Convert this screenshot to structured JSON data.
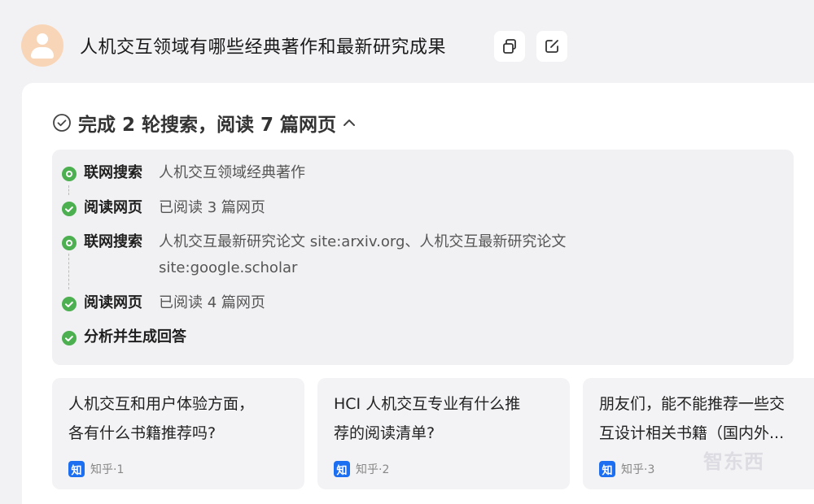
{
  "header": {
    "question": "人机交互领域有哪些经典著作和最新研究成果",
    "copy_icon": "copy-icon",
    "edit_icon": "edit-icon"
  },
  "summary": {
    "text": "完成 2 轮搜索，阅读 7 篇网页",
    "expand_icon": "chevron-up-icon"
  },
  "steps": [
    {
      "label": "联网搜索",
      "detail": "人机交互领域经典著作",
      "icon": "search-step-icon"
    },
    {
      "label": "阅读网页",
      "detail": "已阅读 3 篇网页",
      "icon": "check-icon"
    },
    {
      "label": "联网搜索",
      "detail": "人机交互最新研究论文 site:arxiv.org、人机交互最新研究论文",
      "detail2": "site:google.scholar",
      "icon": "search-step-icon"
    },
    {
      "label": "阅读网页",
      "detail": "已阅读 4 篇网页",
      "icon": "check-icon"
    },
    {
      "label": "分析并生成回答",
      "icon": "check-icon"
    }
  ],
  "references": [
    {
      "line1": "人机交互和用户体验方面，",
      "line2": "各有什么书籍推荐吗?",
      "badge": "知",
      "source": "知乎·1"
    },
    {
      "line1": "HCI 人机交互专业有什么推",
      "line2": "荐的阅读清单?",
      "badge": "知",
      "source": "知乎·2"
    },
    {
      "line1": "朋友们，能不能推荐一些交",
      "line2": "互设计相关书籍（国内外...",
      "badge": "知",
      "source": "知乎·3"
    }
  ],
  "watermark": "智东西",
  "colors": {
    "accent_green": "#4caf50",
    "zhihu_blue": "#1d6ff2",
    "avatar_bg": "#f8d5b6"
  }
}
